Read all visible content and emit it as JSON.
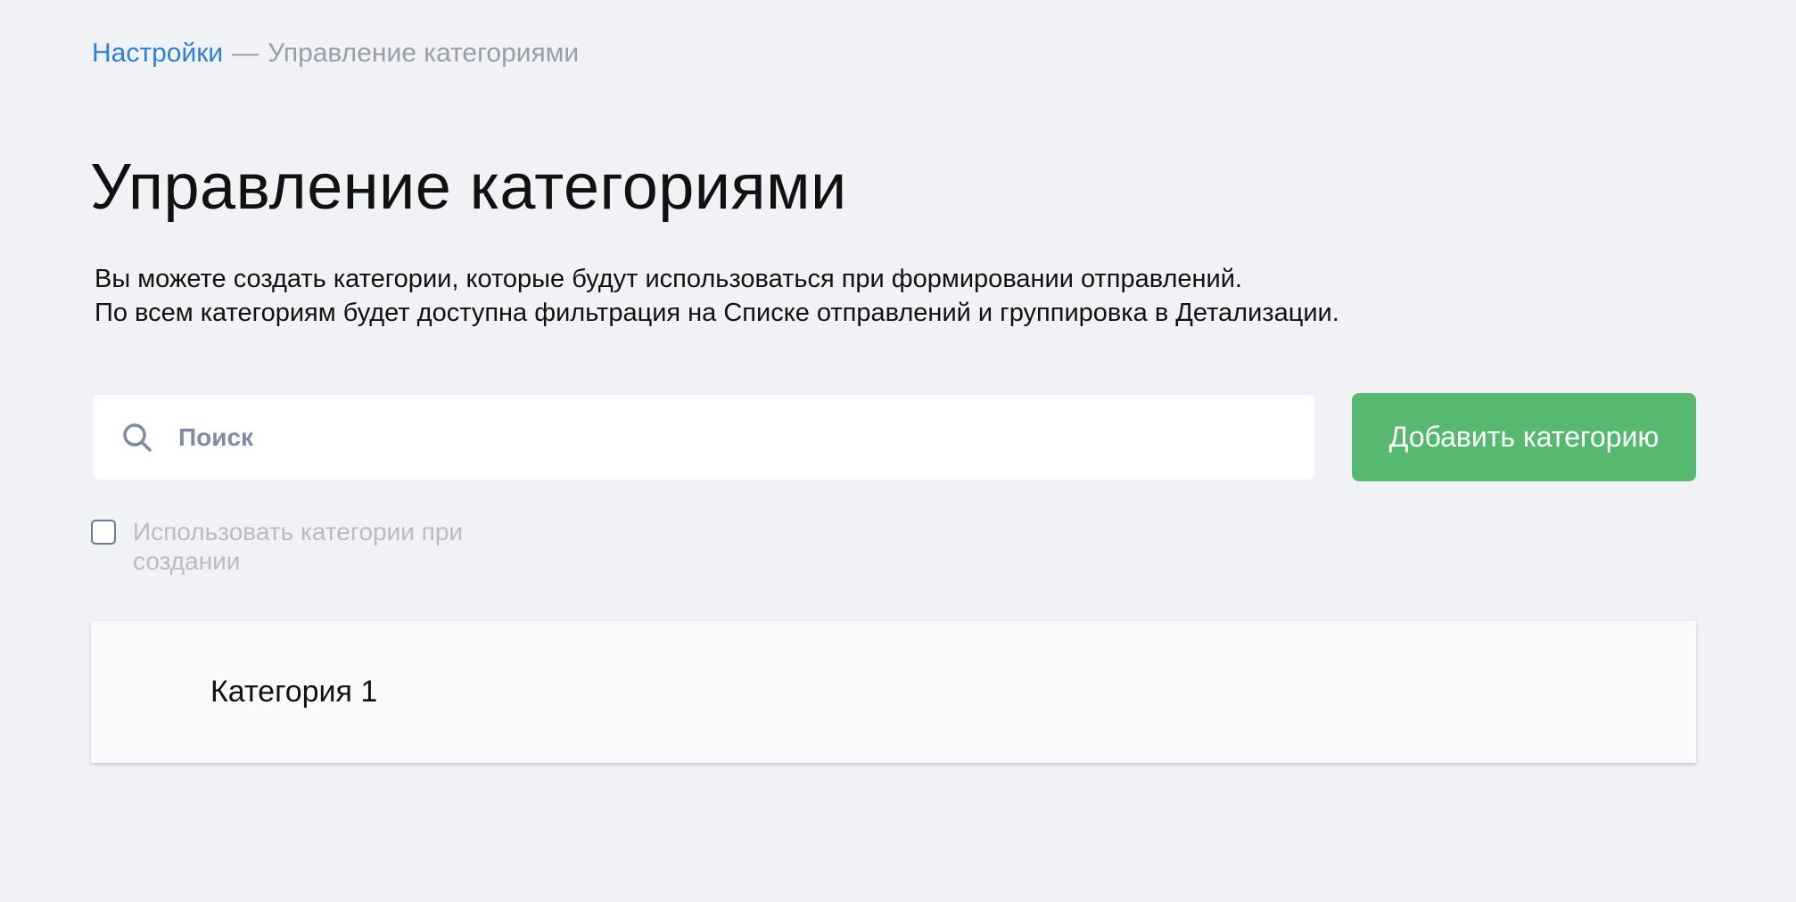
{
  "breadcrumb": {
    "parent": "Настройки",
    "separator": "—",
    "current": "Управление категориями"
  },
  "page": {
    "title": "Управление категориями",
    "description": [
      "Вы можете создать категории, которые будут использоваться при формировании отправлений.",
      "По всем категориям будет доступна фильтрация на Списке отправлений и группировка в Детализации."
    ]
  },
  "search": {
    "placeholder": "Поиск",
    "value": "",
    "icon": "search-icon"
  },
  "actions": {
    "add_category_label": "Добавить категорию"
  },
  "options": {
    "use_categories_label": "Использовать категории при создании",
    "use_categories_checked": false
  },
  "categories": [
    {
      "name": "Категория 1"
    }
  ],
  "colors": {
    "background": "#f0f2f5",
    "link": "#2f7fd3",
    "muted_text": "#9a9ea6",
    "primary_button": "#56b96f",
    "checkbox_border": "#6a7c97",
    "search_icon": "#7d8ba3",
    "card_background": "#f9fafc"
  }
}
